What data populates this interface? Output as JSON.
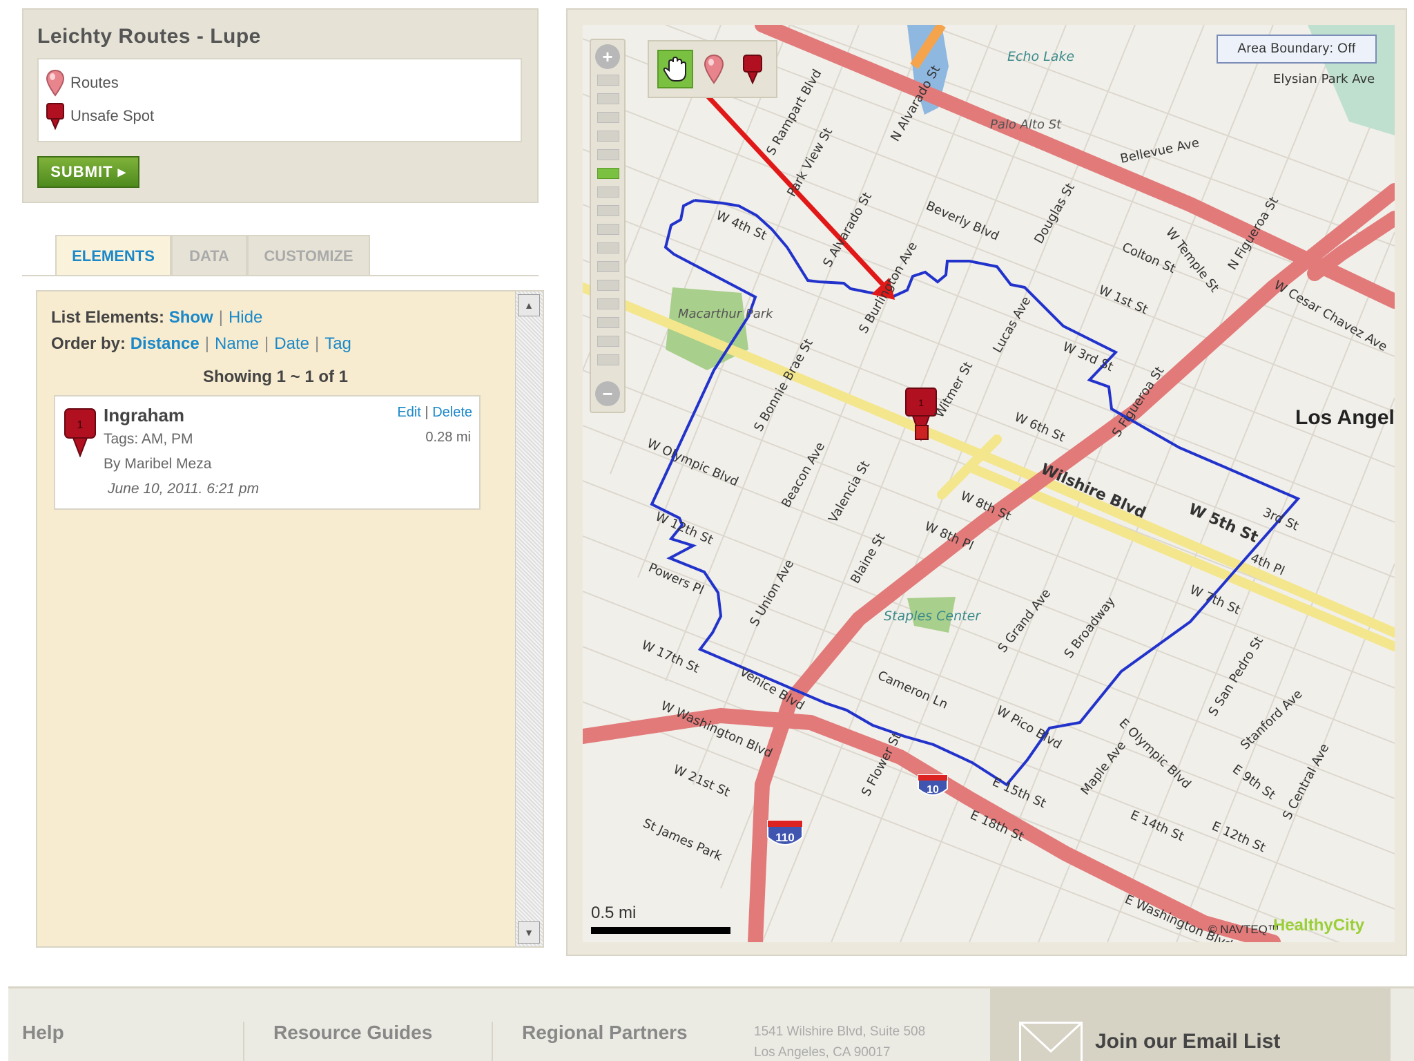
{
  "panel": {
    "title": "Leichty Routes - Lupe",
    "legend": [
      {
        "label": "Routes",
        "icon": "pink-pin-icon",
        "color": "#e8848c"
      },
      {
        "label": "Unsafe Spot",
        "icon": "red-pin-icon",
        "color": "#b01020"
      }
    ],
    "submit_label": "SUBMIT ▸"
  },
  "tabs": [
    "ELEMENTS",
    "DATA",
    "CUSTOMIZE"
  ],
  "active_tab": "ELEMENTS",
  "list": {
    "list_elements_label": "List Elements:",
    "show_label": "Show",
    "hide_label": "Hide",
    "order_by_label": "Order by:",
    "order_options": [
      "Distance",
      "Name",
      "Date",
      "Tag"
    ],
    "showing_text": "Showing 1 ~ 1 of 1",
    "items": [
      {
        "pin_number": "1",
        "name": "Ingraham",
        "tags": "Tags: AM, PM",
        "by": "By Maribel Meza",
        "date": "June 10, 2011. 6:21 pm",
        "distance": "0.28 mi",
        "edit_label": "Edit",
        "delete_label": "Delete"
      }
    ]
  },
  "map": {
    "area_boundary_label": "Area Boundary: Off",
    "city_label": "Los Angele",
    "scale_label": "0.5 mi",
    "copyright": "© NAVTEQ™",
    "logo": "HealthyCity",
    "zoom_levels": 16,
    "zoom_active_level": 5,
    "route_color": "#2233cc",
    "highway_color": "#e27a7a",
    "arrow_color": "#e01818",
    "shields": [
      "110",
      "10"
    ],
    "place_labels": [
      "Echo Lake",
      "Macarthur Park",
      "Staples Center",
      "Palo Alto St"
    ],
    "streets": [
      "W 4th St",
      "Beverly Blvd",
      "Colton St",
      "W 1st St",
      "W 3rd St",
      "W 6th St",
      "Wilshire Blvd",
      "W 5th St",
      "W 8th St",
      "W 8th Pl",
      "W 7th St",
      "W Olympic Blvd",
      "W 12th St",
      "Powers Pl",
      "W 17th St",
      "Venice Blvd",
      "W Washington Blvd",
      "W 21st St",
      "St James Park",
      "E 15th St",
      "E 18th St",
      "E 14th St",
      "E 12th St",
      "E 9th St",
      "E Washington Blvd",
      "Cameron Ln",
      "W Pico Blvd",
      "S Grand Ave",
      "S Broadway",
      "S Flower St",
      "S Figueroa St",
      "Blaine St",
      "Valencia St",
      "Beacon Ave",
      "S Bonnie Brae St",
      "Lucas Ave",
      "Douglas St",
      "N Alvarado St",
      "Bellevue Ave",
      "W Temple St",
      "N Figueroa St",
      "W Cesar Chavez Ave",
      "E Olympic Blvd",
      "Maple Ave",
      "S San Pedro St",
      "Stanford Ave",
      "S Central Ave",
      "4th Pl",
      "3rd St",
      "S Burlington Ave",
      "S Rampart Blvd",
      "Park View St",
      "Elysian Park Ave",
      "S Alvarado St",
      "Witmer St",
      "S Union Ave"
    ]
  },
  "footer": {
    "links": [
      "Help",
      "Resource Guides",
      "Regional Partners"
    ],
    "address_line1": "1541 Wilshire Blvd, Suite 508",
    "address_line2": "Los Angeles, CA 90017",
    "email_label": "Join our Email List"
  }
}
